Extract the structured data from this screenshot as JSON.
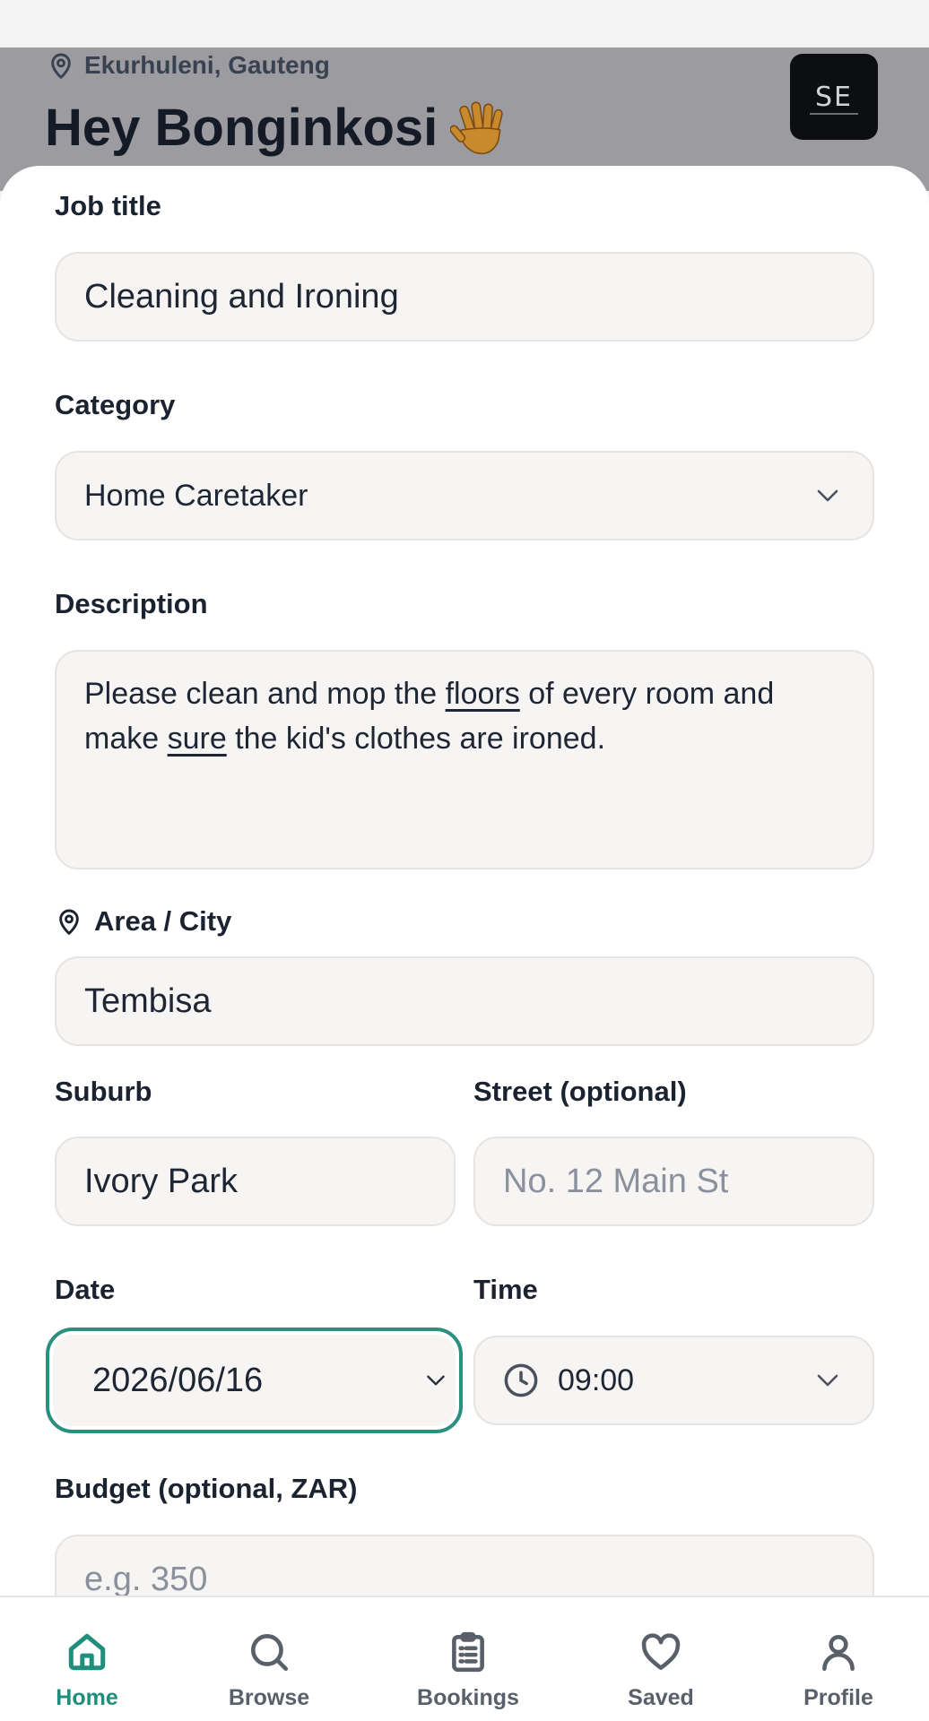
{
  "header": {
    "location": "Ekurhuleni, Gauteng",
    "greeting": "Hey Bonginkosi",
    "avatar_initials": "SE"
  },
  "form": {
    "job_title": {
      "label": "Job title",
      "value": "Cleaning and Ironing"
    },
    "category": {
      "label": "Category",
      "value": "Home Caretaker"
    },
    "description": {
      "label": "Description",
      "text_parts": [
        "Please clean and mop the ",
        "floors",
        " of every room and ",
        "make ",
        "sure",
        " the kid's clothes are ironed."
      ]
    },
    "area": {
      "label": "Area / City",
      "value": "Tembisa"
    },
    "suburb": {
      "label": "Suburb",
      "value": "Ivory Park"
    },
    "street": {
      "label": "Street (optional)",
      "placeholder": "No. 12 Main St"
    },
    "date": {
      "label": "Date",
      "value": "2026/06/16"
    },
    "time": {
      "label": "Time",
      "value": "09:00"
    },
    "budget": {
      "label": "Budget (optional, ZAR)",
      "placeholder": "e.g. 350"
    }
  },
  "nav": {
    "items": [
      {
        "label": "Home",
        "icon": "home-icon",
        "active": true
      },
      {
        "label": "Browse",
        "icon": "search-icon",
        "active": false
      },
      {
        "label": "Bookings",
        "icon": "clipboard-icon",
        "active": false
      },
      {
        "label": "Saved",
        "icon": "heart-icon",
        "active": false
      },
      {
        "label": "Profile",
        "icon": "user-icon",
        "active": false
      }
    ]
  },
  "colors": {
    "accent": "#1f8f7c",
    "header_bg": "#9b9ba0",
    "field_bg": "#f6f5f4"
  }
}
